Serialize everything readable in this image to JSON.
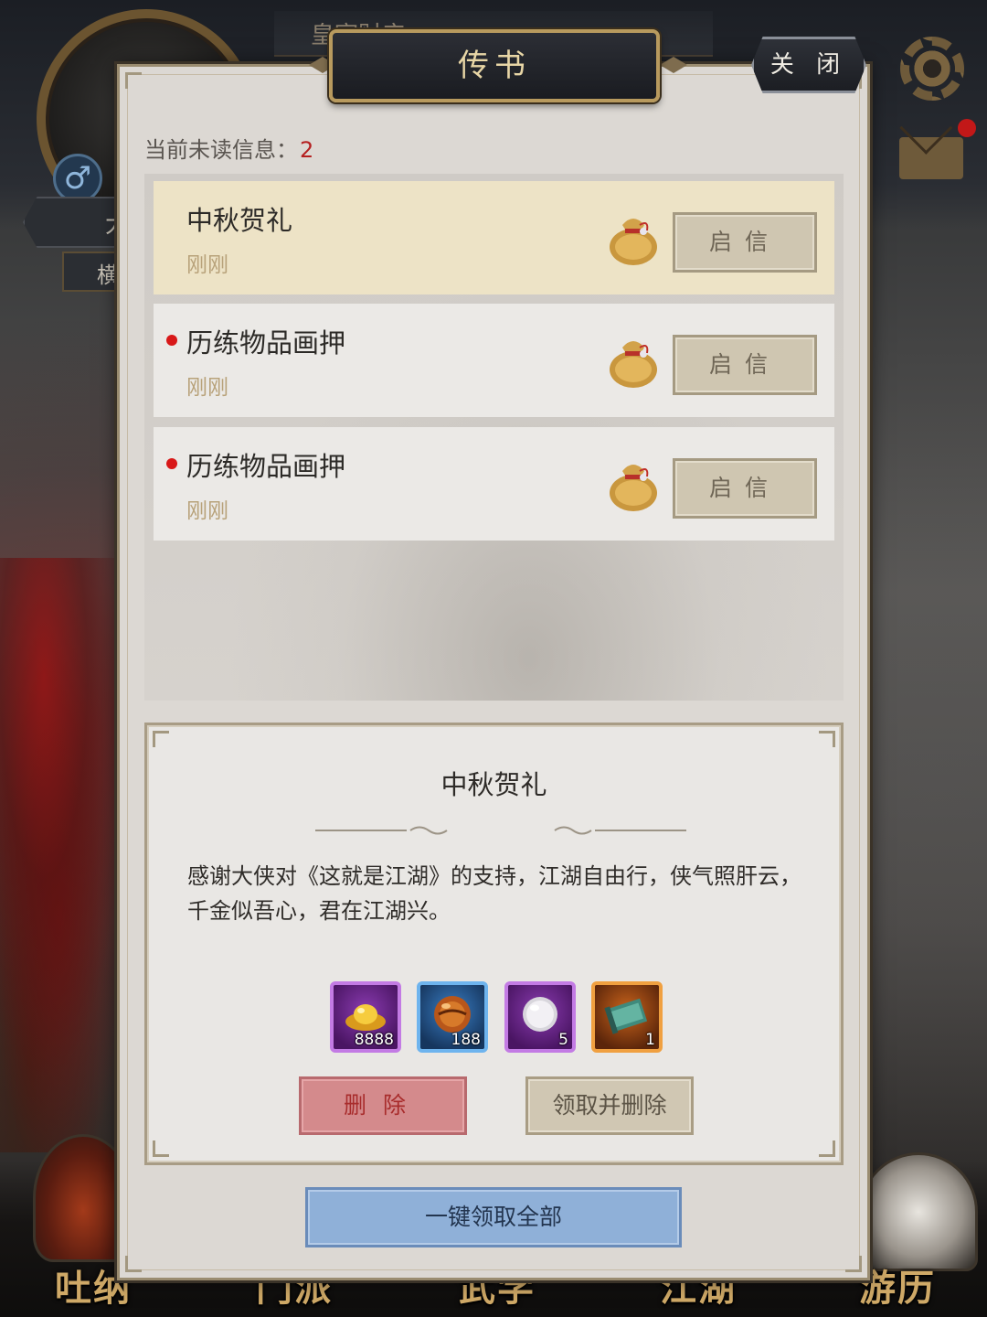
{
  "background": {
    "header_text": "皇室财产",
    "name_fragment_1": "大",
    "name_fragment_2": "横",
    "gender_symbol": "♂",
    "bottom_nav": [
      "吐纳",
      "门派",
      "武学",
      "江湖",
      "游历"
    ]
  },
  "panel": {
    "title": "传书",
    "close_label": "关 闭",
    "unread_label": "当前未读信息：",
    "unread_count": "2"
  },
  "mails": [
    {
      "title": "中秋贺礼",
      "time": "刚刚",
      "unread": false,
      "selected": true,
      "open_label": "启信"
    },
    {
      "title": "历练物品画押",
      "time": "刚刚",
      "unread": true,
      "selected": false,
      "open_label": "启信"
    },
    {
      "title": "历练物品画押",
      "time": "刚刚",
      "unread": true,
      "selected": false,
      "open_label": "启信"
    }
  ],
  "detail": {
    "title": "中秋贺礼",
    "body": "感谢大侠对《这就是江湖》的支持，江湖自由行，侠气照肝云，千金似吾心，君在江湖兴。",
    "rewards": [
      {
        "icon": "gold-ingot-icon",
        "qty": "8888",
        "rarity": "purple"
      },
      {
        "icon": "amber-orb-icon",
        "qty": "188",
        "rarity": "blue"
      },
      {
        "icon": "pearl-icon",
        "qty": "5",
        "rarity": "purple"
      },
      {
        "icon": "scroll-icon",
        "qty": "1",
        "rarity": "orange"
      }
    ],
    "delete_label": "删除",
    "claim_delete_label": "领取并删除"
  },
  "claim_all_label": "一键领取全部",
  "colors": {
    "unread_dot": "#d81818",
    "unread_count": "#b52020",
    "selected_row": "#ede3c6",
    "delete_button": "#d48a8c",
    "claim_all_button": "#8fb0d8"
  }
}
